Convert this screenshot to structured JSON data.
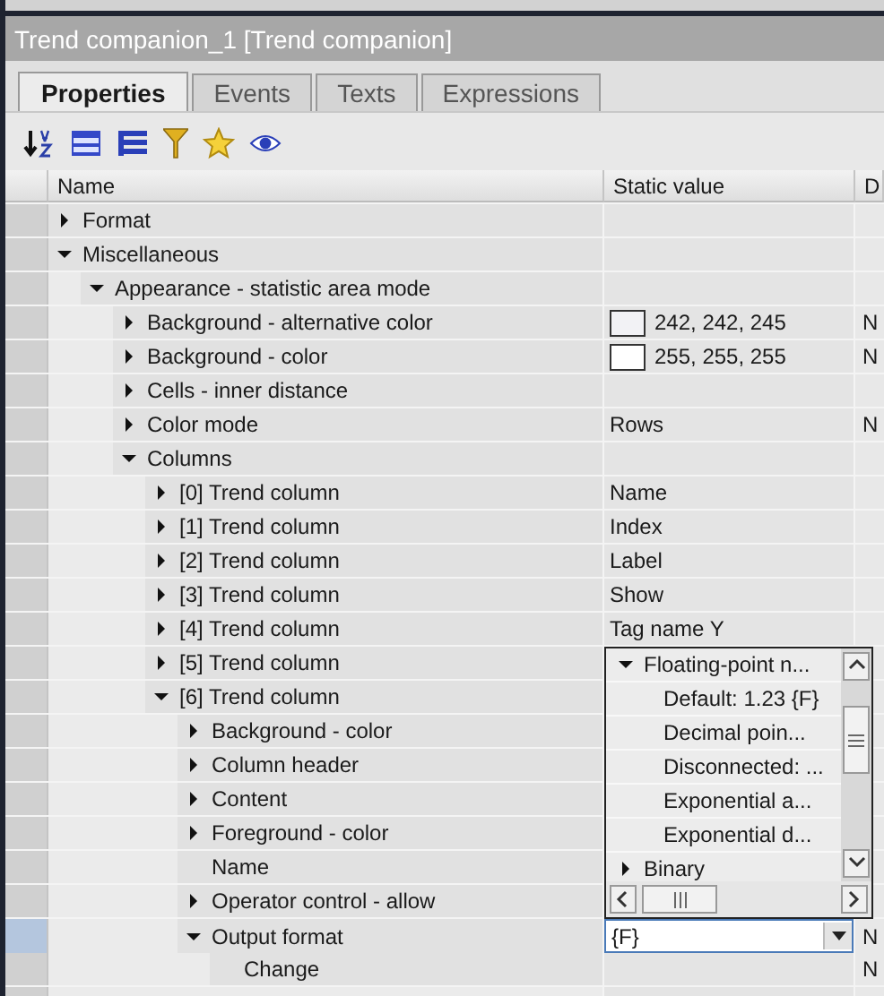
{
  "window": {
    "title": "Trend companion_1 [Trend companion]"
  },
  "tabs": [
    {
      "label": "Properties",
      "selected": true
    },
    {
      "label": "Events",
      "selected": false
    },
    {
      "label": "Texts",
      "selected": false
    },
    {
      "label": "Expressions",
      "selected": false
    }
  ],
  "table": {
    "columns": [
      "Name",
      "Static value",
      "D"
    ],
    "rows": [
      {
        "name": "Format",
        "expanded": false,
        "selected": false
      },
      {
        "name": "Miscellaneous",
        "expanded": true,
        "selected": false,
        "children": [
          {
            "name": "Appearance - statistic area mode",
            "expanded": true,
            "selected": false,
            "children": [
              {
                "name": "Background - alternative color",
                "expanded": false,
                "selected": false,
                "color": "#f2f2f5",
                "value": "242, 242, 245",
                "dynamic": "N"
              },
              {
                "name": "Background - color",
                "expanded": false,
                "selected": false,
                "color": "#ffffff",
                "value": "255, 255, 255",
                "dynamic": "N"
              },
              {
                "name": "Cells - inner distance",
                "expanded": false,
                "selected": false
              },
              {
                "name": "Color mode",
                "expanded": false,
                "selected": false,
                "value": "Rows",
                "dynamic": "N"
              },
              {
                "name": "Columns",
                "expanded": true,
                "selected": false,
                "children": [
                  {
                    "name": "[0] Trend column",
                    "expanded": false,
                    "selected": false,
                    "value": "Name"
                  },
                  {
                    "name": "[1] Trend column",
                    "expanded": false,
                    "selected": false,
                    "value": "Index"
                  },
                  {
                    "name": "[2] Trend column",
                    "expanded": false,
                    "selected": false,
                    "value": "Label"
                  },
                  {
                    "name": "[3] Trend column",
                    "expanded": false,
                    "selected": false,
                    "value": "Show"
                  },
                  {
                    "name": "[4] Trend column",
                    "expanded": false,
                    "selected": false,
                    "value": "Tag name Y"
                  },
                  {
                    "name": "[5] Trend column",
                    "expanded": false,
                    "selected": false
                  },
                  {
                    "name": "[6] Trend column",
                    "expanded": true,
                    "selected": false,
                    "children": [
                      {
                        "name": "Background - color",
                        "expanded": false,
                        "selected": false
                      },
                      {
                        "name": "Column header",
                        "expanded": false,
                        "selected": false
                      },
                      {
                        "name": "Content",
                        "expanded": false,
                        "selected": false
                      },
                      {
                        "name": "Foreground - color",
                        "expanded": false,
                        "selected": false
                      },
                      {
                        "name": "Name",
                        "selected": false
                      },
                      {
                        "name": "Operator control - allow",
                        "expanded": false,
                        "selected": false
                      },
                      {
                        "name": "Output format",
                        "expanded": true,
                        "selected": true,
                        "value": "{F}",
                        "dynamic": "N",
                        "children": [
                          {
                            "name": "Change",
                            "selected": false,
                            "dynamic": "N"
                          }
                        ]
                      }
                    ]
                  }
                ]
              }
            ]
          }
        ]
      }
    ]
  },
  "dropdown": {
    "items": [
      {
        "label": "Floating-point n...",
        "expanded": true,
        "children": [
          {
            "label": "Default: 1.23 {F}"
          },
          {
            "label": "Decimal poin..."
          },
          {
            "label": "Disconnected: ..."
          },
          {
            "label": "Exponential a..."
          },
          {
            "label": "Exponential d..."
          }
        ]
      },
      {
        "label": "Binary",
        "expanded": false
      }
    ]
  }
}
